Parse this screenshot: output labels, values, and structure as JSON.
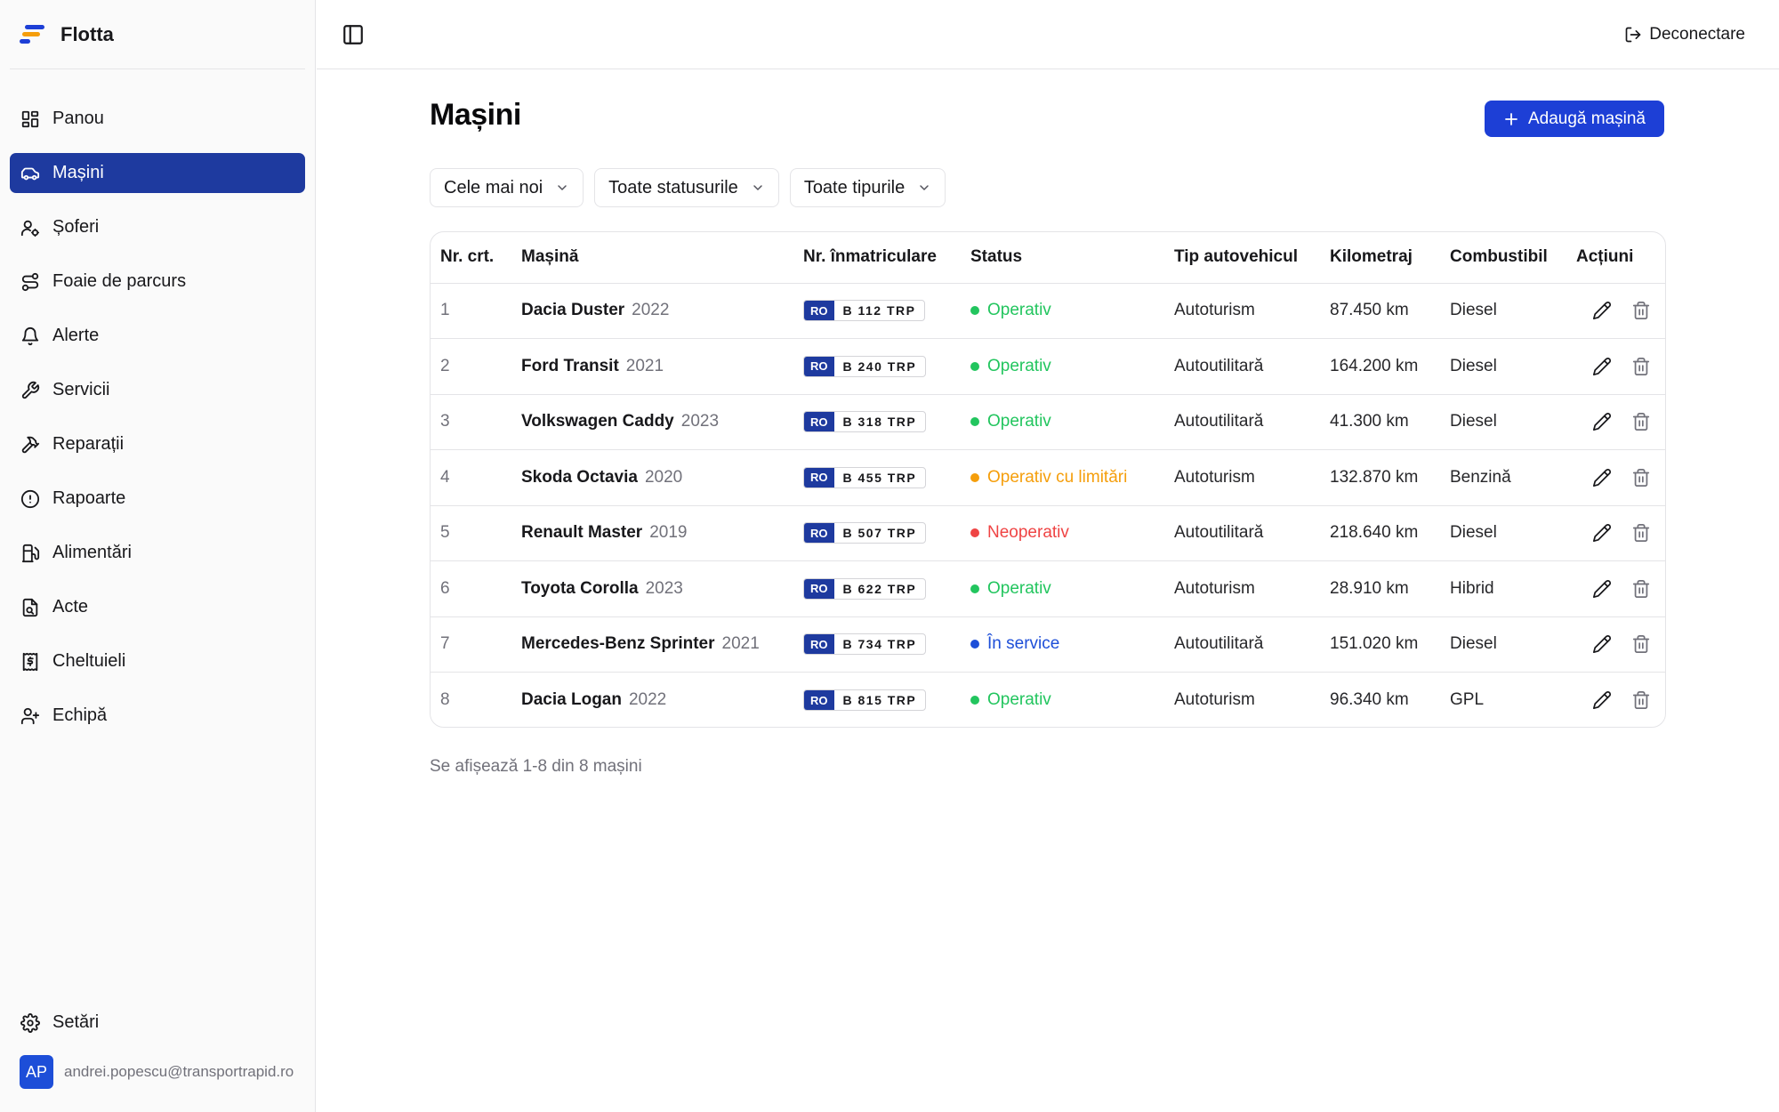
{
  "app": {
    "name": "Flotta"
  },
  "sidebar": {
    "items": [
      {
        "label": "Panou",
        "icon": "dashboard-icon",
        "active": false
      },
      {
        "label": "Mașini",
        "icon": "car-icon",
        "active": true
      },
      {
        "label": "Șoferi",
        "icon": "driver-icon",
        "active": false
      },
      {
        "label": "Foaie de parcurs",
        "icon": "route-icon",
        "active": false
      },
      {
        "label": "Alerte",
        "icon": "bell-icon",
        "active": false
      },
      {
        "label": "Servicii",
        "icon": "wrench-icon",
        "active": false
      },
      {
        "label": "Reparații",
        "icon": "hammer-icon",
        "active": false
      },
      {
        "label": "Rapoarte",
        "icon": "alert-circle-icon",
        "active": false
      },
      {
        "label": "Alimentări",
        "icon": "fuel-icon",
        "active": false
      },
      {
        "label": "Acte",
        "icon": "document-icon",
        "active": false
      },
      {
        "label": "Cheltuieli",
        "icon": "receipt-icon",
        "active": false
      },
      {
        "label": "Echipă",
        "icon": "user-plus-icon",
        "active": false
      }
    ],
    "settings_label": "Setări",
    "user": {
      "initials": "AP",
      "email": "andrei.popescu@transportrapid.ro"
    }
  },
  "topbar": {
    "logout_label": "Deconectare"
  },
  "page": {
    "title": "Mașini",
    "add_button_label": "Adaugă mașină",
    "filters": {
      "sort": "Cele mai noi",
      "status": "Toate statusurile",
      "type": "Toate tipurile"
    },
    "footer_text": "Se afișează 1-8 din 8 mașini"
  },
  "colors": {
    "accent": "#1d3fd6",
    "sidebar_active": "#1e3a9f",
    "status_operativ": "#22c55e",
    "status_limitari": "#f59e0b",
    "status_neoperativ": "#ef4444",
    "status_service": "#1d4ed8"
  },
  "table": {
    "headers": {
      "nr": "Nr. crt.",
      "car": "Mașină",
      "plate": "Nr. înmatriculare",
      "status": "Status",
      "type": "Tip autovehicul",
      "km": "Kilometraj",
      "fuel": "Combustibil",
      "actions": "Acțiuni"
    },
    "rows": [
      {
        "nr": "1",
        "name": "Dacia Duster",
        "year": "2022",
        "country": "RO",
        "plate": "B 112 TRP",
        "status": "Operativ",
        "status_color": "#22c55e",
        "type": "Autoturism",
        "km": "87.450 km",
        "fuel": "Diesel"
      },
      {
        "nr": "2",
        "name": "Ford Transit",
        "year": "2021",
        "country": "RO",
        "plate": "B 240 TRP",
        "status": "Operativ",
        "status_color": "#22c55e",
        "type": "Autoutilitară",
        "km": "164.200 km",
        "fuel": "Diesel"
      },
      {
        "nr": "3",
        "name": "Volkswagen Caddy",
        "year": "2023",
        "country": "RO",
        "plate": "B 318 TRP",
        "status": "Operativ",
        "status_color": "#22c55e",
        "type": "Autoutilitară",
        "km": "41.300 km",
        "fuel": "Diesel"
      },
      {
        "nr": "4",
        "name": "Skoda Octavia",
        "year": "2020",
        "country": "RO",
        "plate": "B 455 TRP",
        "status": "Operativ cu limitări",
        "status_color": "#f59e0b",
        "type": "Autoturism",
        "km": "132.870 km",
        "fuel": "Benzină"
      },
      {
        "nr": "5",
        "name": "Renault Master",
        "year": "2019",
        "country": "RO",
        "plate": "B 507 TRP",
        "status": "Neoperativ",
        "status_color": "#ef4444",
        "type": "Autoutilitară",
        "km": "218.640 km",
        "fuel": "Diesel"
      },
      {
        "nr": "6",
        "name": "Toyota Corolla",
        "year": "2023",
        "country": "RO",
        "plate": "B 622 TRP",
        "status": "Operativ",
        "status_color": "#22c55e",
        "type": "Autoturism",
        "km": "28.910 km",
        "fuel": "Hibrid"
      },
      {
        "nr": "7",
        "name": "Mercedes-Benz Sprinter",
        "year": "2021",
        "country": "RO",
        "plate": "B 734 TRP",
        "status": "În service",
        "status_color": "#1d4ed8",
        "type": "Autoutilitară",
        "km": "151.020 km",
        "fuel": "Diesel"
      },
      {
        "nr": "8",
        "name": "Dacia Logan",
        "year": "2022",
        "country": "RO",
        "plate": "B 815 TRP",
        "status": "Operativ",
        "status_color": "#22c55e",
        "type": "Autoturism",
        "km": "96.340 km",
        "fuel": "GPL"
      }
    ]
  }
}
